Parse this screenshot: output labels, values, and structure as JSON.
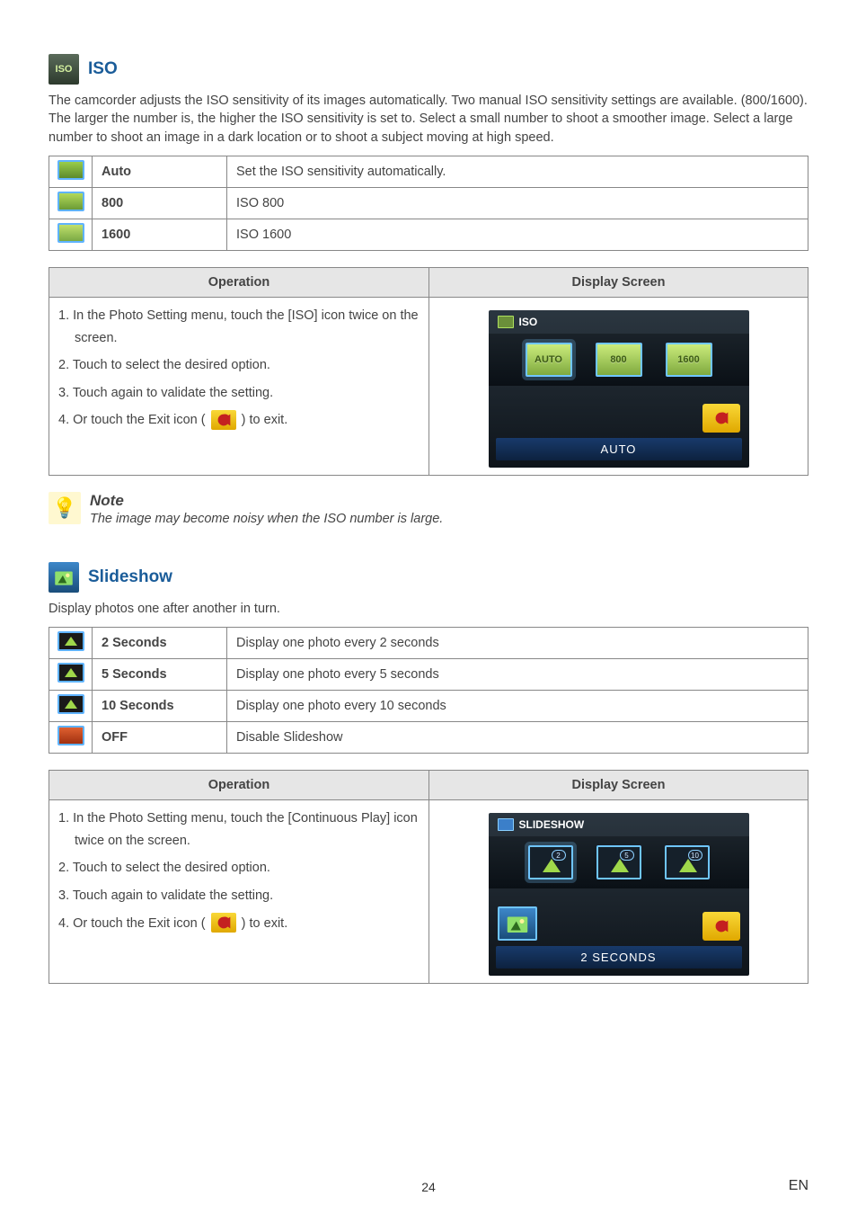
{
  "iso": {
    "title": "ISO",
    "description": "The camcorder adjusts the ISO sensitivity of its images automatically. Two manual ISO sensitivity settings are available. (800/1600). The larger the number is, the higher the ISO sensitivity is set to. Select a small number to shoot a smoother image. Select a large number to shoot an image in a dark location or to shoot a subject moving at high speed.",
    "options": [
      {
        "name": "Auto",
        "desc": "Set the ISO sensitivity automatically."
      },
      {
        "name": "800",
        "desc": "ISO 800"
      },
      {
        "name": "1600",
        "desc": "ISO 1600"
      }
    ],
    "op_header": "Operation",
    "ds_header": "Display Screen",
    "steps": [
      "1. In the Photo Setting menu, touch the [ISO] icon twice on the screen.",
      "2. Touch to select the desired option.",
      "3. Touch again to validate the setting.",
      "4. Or touch the Exit icon ( ",
      " ) to exit."
    ],
    "ds_title": "ISO",
    "ds_opts": [
      "AUTO",
      "800",
      "1600"
    ],
    "ds_footer": "AUTO"
  },
  "note": {
    "title": "Note",
    "text": "The image may become noisy when the ISO number is large."
  },
  "slideshow": {
    "title": "Slideshow",
    "description": "Display photos one after another in turn.",
    "options": [
      {
        "name": "2 Seconds",
        "desc": "Display one photo every 2 seconds"
      },
      {
        "name": "5 Seconds",
        "desc": "Display one photo every 5 seconds"
      },
      {
        "name": "10 Seconds",
        "desc": "Display one photo every 10 seconds"
      },
      {
        "name": "OFF",
        "desc": "Disable Slideshow"
      }
    ],
    "op_header": "Operation",
    "ds_header": "Display Screen",
    "steps": [
      "1. In the Photo Setting menu, touch the [Continuous Play] icon twice on the screen.",
      "2. Touch to select the desired option.",
      "3. Touch again to validate the setting.",
      "4. Or touch the Exit icon ( ",
      " ) to exit."
    ],
    "ds_title": "SLIDESHOW",
    "ds_badges": [
      "2",
      "5",
      "10"
    ],
    "ds_footer": "2 SECONDS"
  },
  "footer": {
    "page": "24",
    "lang": "EN"
  }
}
